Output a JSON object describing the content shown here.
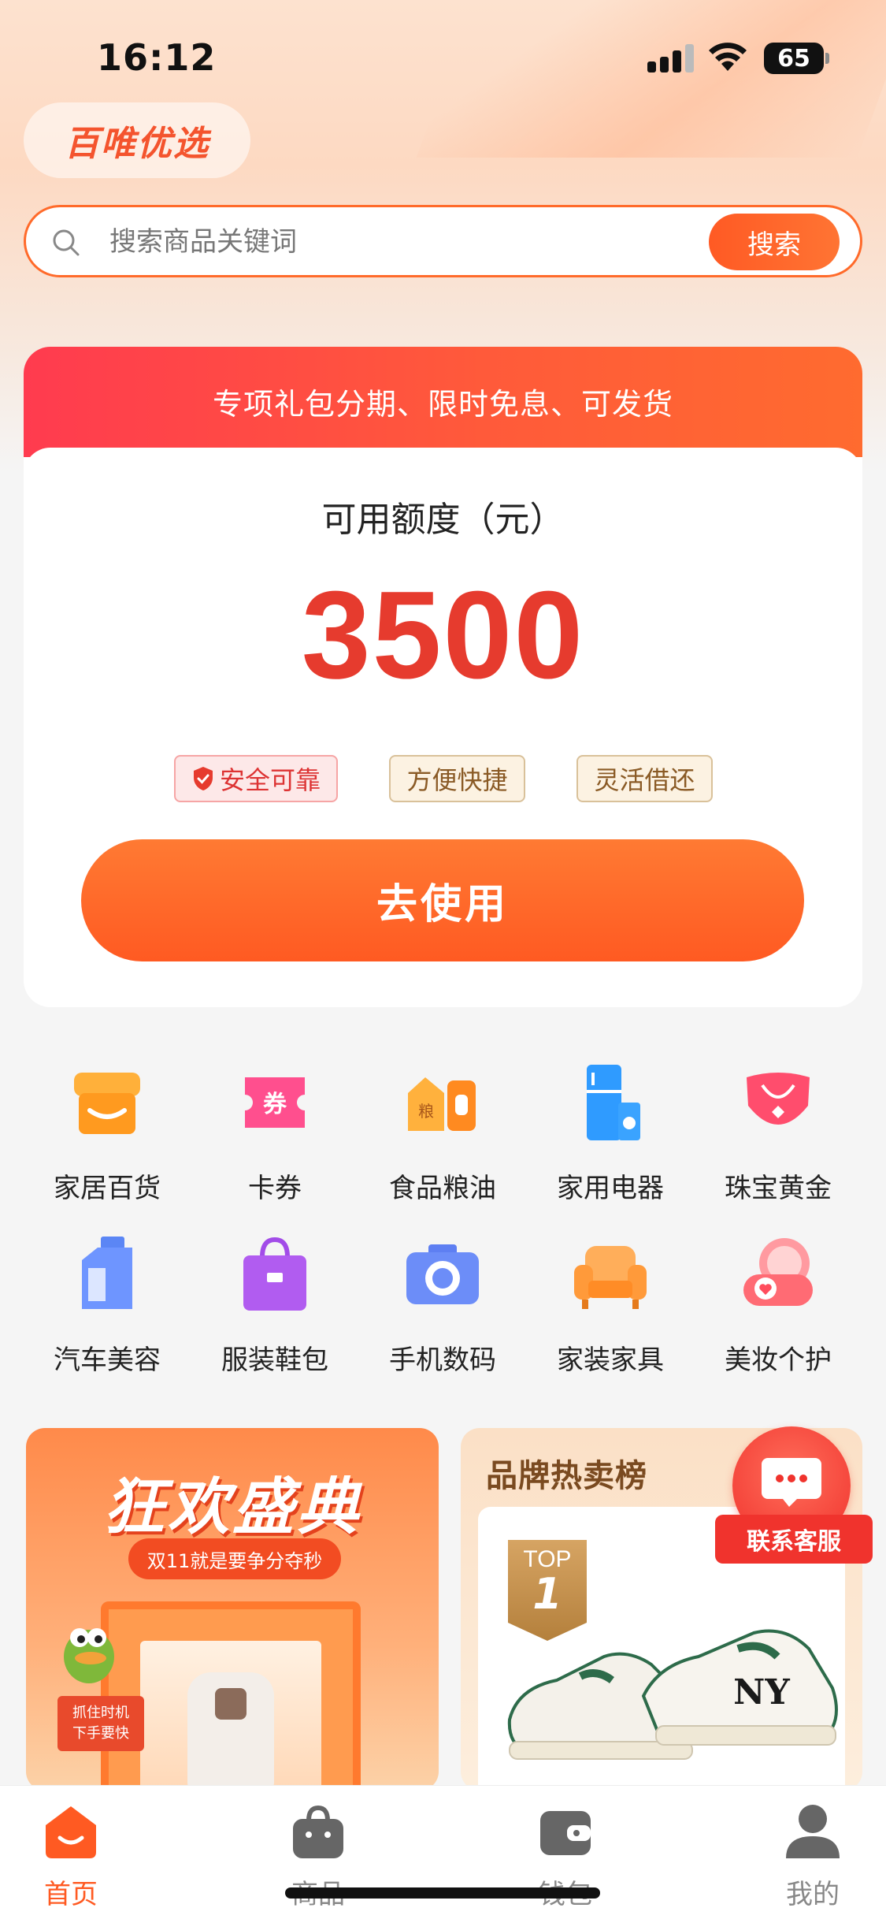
{
  "status": {
    "time": "16:12",
    "battery": "65"
  },
  "brand": {
    "logo_text": "百唯优选"
  },
  "search": {
    "placeholder": "搜索商品关键词",
    "button": "搜索"
  },
  "credit_card": {
    "banner": "专项礼包分期、限时免息、可发货",
    "label": "可用额度（元）",
    "amount": "3500",
    "tags": [
      "安全可靠",
      "方便快捷",
      "灵活借还"
    ],
    "action": "去使用"
  },
  "categories": [
    {
      "label": "家居百货",
      "icon": "store-icon"
    },
    {
      "label": "卡券",
      "icon": "coupon-icon"
    },
    {
      "label": "食品粮油",
      "icon": "grain-oil-icon"
    },
    {
      "label": "家用电器",
      "icon": "fridge-icon"
    },
    {
      "label": "珠宝黄金",
      "icon": "necklace-icon"
    },
    {
      "label": "汽车美容",
      "icon": "car-care-bottle-icon"
    },
    {
      "label": "服装鞋包",
      "icon": "handbag-icon"
    },
    {
      "label": "手机数码",
      "icon": "camera-icon"
    },
    {
      "label": "家装家具",
      "icon": "sofa-icon"
    },
    {
      "label": "美妆个护",
      "icon": "compact-icon"
    }
  ],
  "promo_left": {
    "title": "狂欢盛典",
    "subtitle": "双11就是要争分夺秒",
    "tag_line1": "抓住时机",
    "tag_line2": "下手要快"
  },
  "promo_right": {
    "title": "品牌热卖榜",
    "badge_top": "TOP",
    "badge_rank": "1"
  },
  "service": {
    "label": "联系客服"
  },
  "tabbar": [
    {
      "label": "首页",
      "icon": "home-icon",
      "active": true
    },
    {
      "label": "商品",
      "icon": "shopping-bag-icon",
      "active": false
    },
    {
      "label": "钱包",
      "icon": "wallet-icon",
      "active": false
    },
    {
      "label": "我的",
      "icon": "profile-icon",
      "active": false
    }
  ],
  "colors": {
    "accent": "#ff5a22",
    "amount": "#e63b2e",
    "banner_start": "#ff3b4f"
  }
}
